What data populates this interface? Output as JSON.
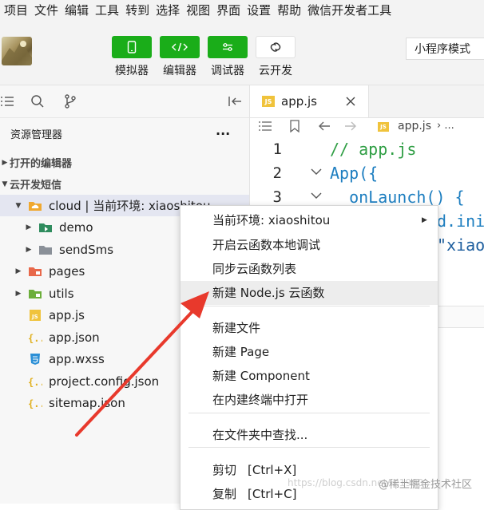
{
  "menubar": [
    "项目",
    "文件",
    "编辑",
    "工具",
    "转到",
    "选择",
    "视图",
    "界面",
    "设置",
    "帮助",
    "微信开发者工具"
  ],
  "toolbar": {
    "buttons": [
      {
        "label": "模拟器",
        "icon": "phone-icon"
      },
      {
        "label": "编辑器",
        "icon": "code-icon"
      },
      {
        "label": "调试器",
        "icon": "sliders-icon"
      },
      {
        "label": "云开发",
        "icon": "cloud-link-icon"
      }
    ],
    "mode": "小程序模式"
  },
  "sidebar": {
    "title": "资源管理器",
    "more": "···",
    "sec_open": "打开的编辑器",
    "sec_project": "云开发短信",
    "items": [
      {
        "label": "cloud | 当前环境: xiaoshitou",
        "type": "folder-cloud",
        "depth": 0,
        "expanded": true
      },
      {
        "label": "demo",
        "type": "folder-cloud-fn",
        "depth": 1
      },
      {
        "label": "sendSms",
        "type": "folder",
        "depth": 1
      },
      {
        "label": "pages",
        "type": "folder-pages",
        "depth": 0
      },
      {
        "label": "utils",
        "type": "folder-utils",
        "depth": 0
      },
      {
        "label": "app.js",
        "type": "js",
        "depth": 0
      },
      {
        "label": "app.json",
        "type": "json",
        "depth": 0
      },
      {
        "label": "app.wxss",
        "type": "css",
        "depth": 0
      },
      {
        "label": "project.config.json",
        "type": "json",
        "depth": 0
      },
      {
        "label": "sitemap.json",
        "type": "json",
        "depth": 0
      }
    ]
  },
  "editor": {
    "tab": "app.js",
    "tab_icon": "JS",
    "breadcrumb": "app.js",
    "breadcrumb_more": "›  ...",
    "lines": [
      {
        "n": "1",
        "text": "// app.js"
      },
      {
        "n": "2",
        "text": "App({"
      },
      {
        "n": "3",
        "text": "  onLaunch() {"
      }
    ],
    "frag1": "d.ini",
    "frag2": "\"xiao"
  },
  "context_menu": {
    "items": [
      {
        "label": "当前环境: xiaoshitou",
        "submenu": true
      },
      {
        "label": "开启云函数本地调试"
      },
      {
        "label": "同步云函数列表"
      },
      {
        "label": "新建 Node.js 云函数",
        "highlight": true
      },
      {
        "label": "新建文件"
      },
      {
        "label": "新建 Page"
      },
      {
        "label": "新建 Component"
      },
      {
        "label": "在内建终端中打开"
      },
      {
        "label": "在文件夹中查找..."
      },
      {
        "label": "剪切",
        "key": "[Ctrl+X]"
      },
      {
        "label": "复制",
        "key": "[Ctrl+C]"
      }
    ]
  },
  "watermark": "https://blog.csdn.net/...1990",
  "badge": "@稀土掘金技术社区",
  "colors": {
    "accent": "#1aad19",
    "arrow": "#e8392c",
    "js": "#f0c33c",
    "css": "#2b8fd6"
  }
}
